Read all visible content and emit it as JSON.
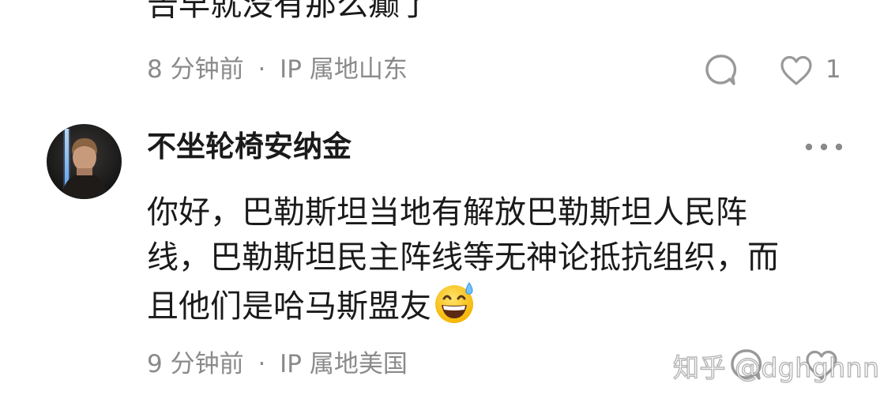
{
  "comments": [
    {
      "text": "告早就没有那么癫了",
      "time": "8 分钟前",
      "separator": "·",
      "location": "IP 属地山东",
      "like_count": "1"
    },
    {
      "username": "不坐轮椅安纳金",
      "text_lines": [
        "你好，巴勒斯坦当地有解放巴勒斯坦人民阵",
        "线，巴勒斯坦民主阵线等无神论抵抗组织，而",
        "且他们是哈马斯盟友"
      ],
      "emoji": "grinning-sweat-emoji",
      "time": "9 分钟前",
      "separator": "·",
      "location": "IP 属地美国"
    }
  ],
  "watermark": "知乎 @dghghnn",
  "icons": {
    "reply": "comment-bubble-icon",
    "like": "heart-icon",
    "more": "more-dots-icon"
  },
  "colors": {
    "text_primary": "#1a1a1a",
    "text_secondary": "#8a8a8a",
    "icon_gray": "#999999"
  }
}
